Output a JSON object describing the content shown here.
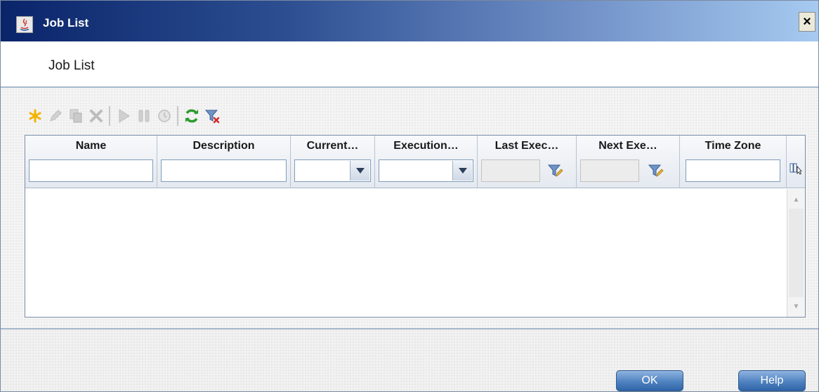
{
  "window": {
    "title": "Job List",
    "close_label": "×"
  },
  "header": {
    "title": "Job List"
  },
  "toolbar": {
    "buttons": [
      {
        "icon": "new-icon",
        "enabled": true
      },
      {
        "icon": "edit-icon",
        "enabled": false
      },
      {
        "icon": "copy-icon",
        "enabled": false
      },
      {
        "icon": "delete-icon",
        "enabled": false
      },
      {
        "icon": "run-icon",
        "enabled": false
      },
      {
        "icon": "pause-icon",
        "enabled": false
      },
      {
        "icon": "schedule-icon",
        "enabled": false
      },
      {
        "icon": "refresh-icon",
        "enabled": true
      },
      {
        "icon": "clear-filter-icon",
        "enabled": true
      }
    ]
  },
  "table": {
    "columns": [
      {
        "label": "Name",
        "filter": "text",
        "value": ""
      },
      {
        "label": "Description",
        "filter": "text",
        "value": ""
      },
      {
        "label": "Current…",
        "filter": "select",
        "value": ""
      },
      {
        "label": "Execution…",
        "filter": "select",
        "value": ""
      },
      {
        "label": "Last Exec…",
        "filter": "date",
        "value": ""
      },
      {
        "label": "Next Exe…",
        "filter": "date",
        "value": ""
      },
      {
        "label": "Time Zone",
        "filter": "text",
        "value": ""
      }
    ],
    "rows": []
  },
  "footer": {
    "ok_label": "OK",
    "help_label": "Help"
  },
  "colors": {
    "accent": "#4f82c0",
    "titlebar_start": "#0a246a",
    "titlebar_end": "#a6caf0",
    "new_icon": "#f2b400",
    "refresh_icon": "#2e9b2e",
    "disabled_icon": "#c4c4c4"
  }
}
